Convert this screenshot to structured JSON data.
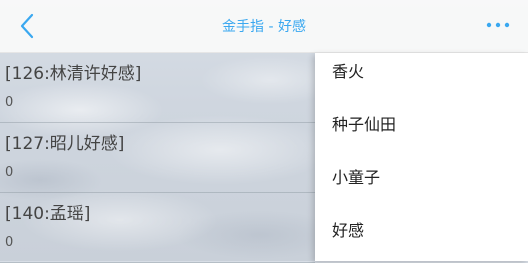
{
  "header": {
    "title": "金手指 - 好感",
    "accent": "#3aa8f0"
  },
  "icons": {
    "back": "chevron-left-icon",
    "more": "more-dots-icon"
  },
  "list": {
    "items": [
      {
        "name": "[126:林清许好感]",
        "value": "0"
      },
      {
        "name": "[127:昭儿好感]",
        "value": "0"
      },
      {
        "name": "[140:孟瑶]",
        "value": "0"
      }
    ]
  },
  "menu": {
    "items": [
      {
        "label": "香火"
      },
      {
        "label": "种子仙田"
      },
      {
        "label": "小童子"
      },
      {
        "label": "好感"
      }
    ]
  }
}
